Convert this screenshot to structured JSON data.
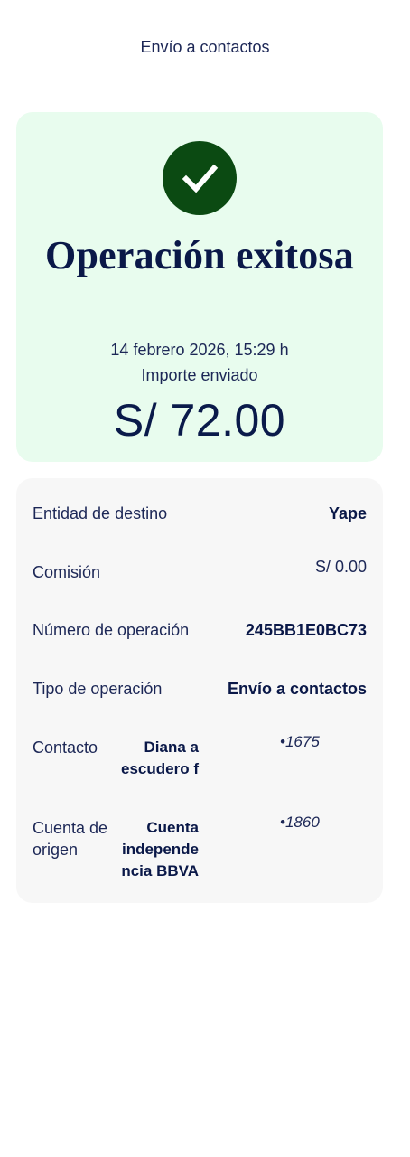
{
  "header": {
    "title": "Envío a contactos"
  },
  "success": {
    "icon": "check-icon",
    "title": "Operación exitosa",
    "datetime": "14 febrero 2026, 15:29 h",
    "amount_label": "Importe enviado",
    "amount": "S/ 72.00",
    "background_color": "#e8fcee",
    "icon_color": "#0b4a12"
  },
  "details": {
    "entidad": {
      "label": "Entidad de destino",
      "value": "Yape"
    },
    "comision": {
      "label": "Comisión",
      "value": "S/ 0.00"
    },
    "numero": {
      "label": "Número de operación",
      "value": "245BB1E0BC73"
    },
    "tipo": {
      "label": "Tipo de operación",
      "value": "Envío a contactos"
    },
    "contacto": {
      "label": "Contacto",
      "name_line1": "Diana a",
      "name_line2": "escudero f",
      "masked": "•1675"
    },
    "cuenta": {
      "label_line1": "Cuenta de",
      "label_line2": "origen",
      "name_line1": "Cuenta",
      "name_line2": "independe",
      "name_line3": "ncia BBVA",
      "masked": "•1860"
    }
  }
}
